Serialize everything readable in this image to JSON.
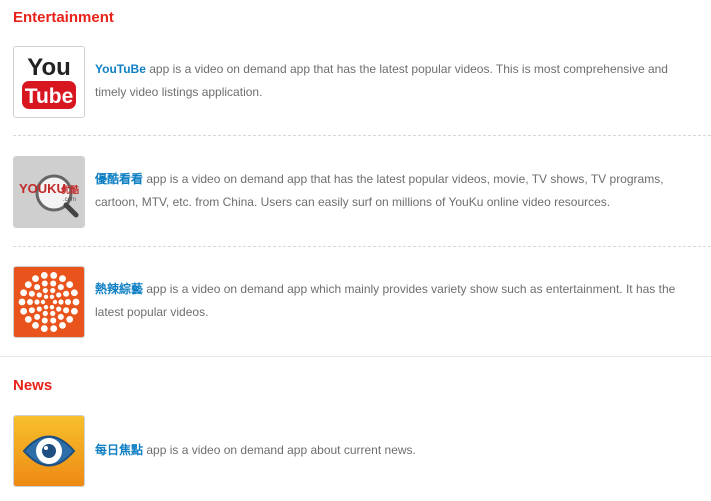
{
  "sections": {
    "entertainment": {
      "title": "Entertainment"
    },
    "news": {
      "title": "News"
    }
  },
  "apps": [
    {
      "name": "YouTuBe",
      "description": " app is a video on demand app that has the latest popular videos. This is most comprehensive and timely video listings application.",
      "icon": "youtube-logo-icon",
      "logo_text_1": "You",
      "logo_text_2": "Tube"
    },
    {
      "name": "優酷看看",
      "description": " app is a video on demand app that has the latest popular videos, movie, TV shows, TV programs, cartoon, MTV, etc. from China. Users can easily surf on millions of YouKu online video resources.",
      "icon": "youku-logo-icon",
      "logo_text_1": "YOUKU",
      "logo_text_2": "优酷",
      "logo_text_3": ".com"
    },
    {
      "name": "熱辣綜藝",
      "description": " app is a video on demand app which mainly provides variety show such as entertainment. It has the latest popular videos.",
      "icon": "variety-dots-icon"
    },
    {
      "name": "每日焦點",
      "description": " app is a video on demand app about current news.",
      "icon": "eye-icon"
    }
  ],
  "colors": {
    "section_title": "#e8221b",
    "link": "#0f7fc4",
    "body_text": "#6e6e6e",
    "youtube_red": "#d7161f",
    "variety_orange": "#e8541c",
    "news_orange": "#f2a01a",
    "eye_blue": "#2d6ea8"
  }
}
